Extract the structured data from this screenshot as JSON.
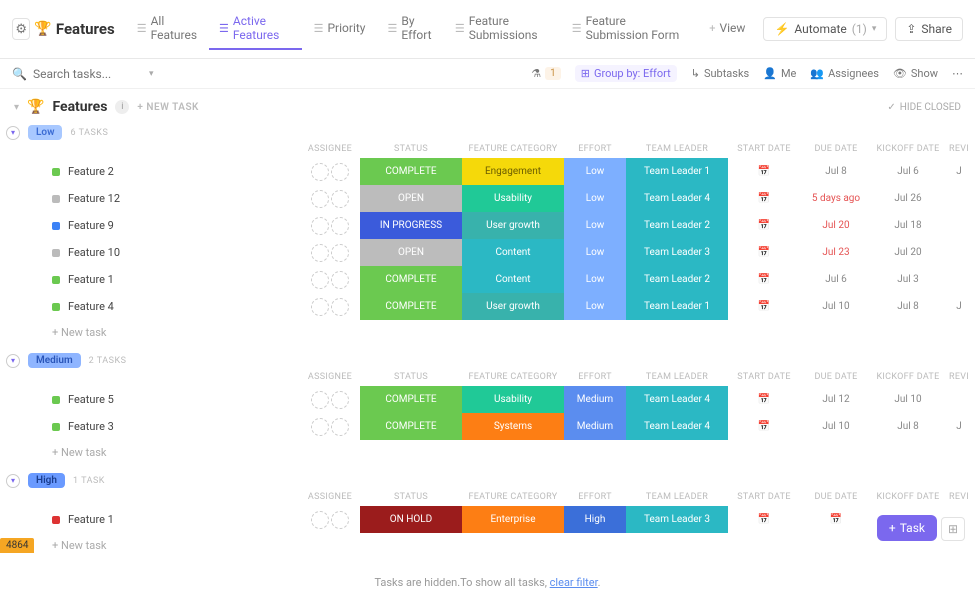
{
  "header": {
    "title": "Features",
    "views": [
      {
        "label": "All Features",
        "active": false
      },
      {
        "label": "Active Features",
        "active": true
      },
      {
        "label": "Priority",
        "active": false
      },
      {
        "label": "By Effort",
        "active": false
      },
      {
        "label": "Feature Submissions",
        "active": false
      },
      {
        "label": "Feature Submission Form",
        "active": false
      }
    ],
    "add_view": "View",
    "automate": "Automate",
    "automate_count": "(1)",
    "share": "Share"
  },
  "filterbar": {
    "search_placeholder": "Search tasks...",
    "filter_count": "1",
    "group_by": "Group by: Effort",
    "subtasks": "Subtasks",
    "me": "Me",
    "assignees": "Assignees",
    "show": "Show"
  },
  "list": {
    "title": "Features",
    "new_task": "+ NEW TASK",
    "hide_closed": "HIDE CLOSED"
  },
  "columns": [
    "",
    "ASSIGNEE",
    "STATUS",
    "FEATURE CATEGORY",
    "EFFORT",
    "TEAM LEADER",
    "START DATE",
    "DUE DATE",
    "KICKOFF DATE",
    "REVI"
  ],
  "groups": [
    {
      "pill": "Low",
      "pill_class": "pill-low",
      "count": "6 TASKS",
      "rows": [
        {
          "sq": "sq-green",
          "name": "Feature 2",
          "status": "COMPLETE",
          "status_c": "status-complete",
          "cat": "Engagement",
          "cat_c": "cat-engagement",
          "eff": "Low",
          "eff_c": "eff-low",
          "leader": "Team Leader 1",
          "due": "Jul 8",
          "due_red": false,
          "kick": "Jul 6",
          "revi": "J"
        },
        {
          "sq": "sq-grey",
          "name": "Feature 12",
          "status": "OPEN",
          "status_c": "status-open",
          "cat": "Usability",
          "cat_c": "cat-usability",
          "eff": "Low",
          "eff_c": "eff-low",
          "leader": "Team Leader 4",
          "due": "5 days ago",
          "due_red": true,
          "kick": "Jul 26",
          "revi": ""
        },
        {
          "sq": "sq-blue",
          "name": "Feature 9",
          "status": "IN PROGRESS",
          "status_c": "status-progress",
          "cat": "User growth",
          "cat_c": "cat-usergrowth",
          "eff": "Low",
          "eff_c": "eff-low",
          "leader": "Team Leader 2",
          "due": "Jul 20",
          "due_red": true,
          "kick": "Jul 18",
          "revi": ""
        },
        {
          "sq": "sq-grey",
          "name": "Feature 10",
          "status": "OPEN",
          "status_c": "status-open",
          "cat": "Content",
          "cat_c": "cat-content",
          "eff": "Low",
          "eff_c": "eff-low",
          "leader": "Team Leader 3",
          "due": "Jul 23",
          "due_red": true,
          "kick": "Jul 20",
          "revi": ""
        },
        {
          "sq": "sq-green",
          "name": "Feature 1",
          "status": "COMPLETE",
          "status_c": "status-complete",
          "cat": "Content",
          "cat_c": "cat-content",
          "eff": "Low",
          "eff_c": "eff-low",
          "leader": "Team Leader 2",
          "due": "Jul 6",
          "due_red": false,
          "kick": "Jul 3",
          "revi": ""
        },
        {
          "sq": "sq-green",
          "name": "Feature 4",
          "status": "COMPLETE",
          "status_c": "status-complete",
          "cat": "User growth",
          "cat_c": "cat-usergrowth",
          "eff": "Low",
          "eff_c": "eff-low",
          "leader": "Team Leader 1",
          "due": "Jul 10",
          "due_red": false,
          "kick": "Jul 8",
          "revi": "J"
        }
      ]
    },
    {
      "pill": "Medium",
      "pill_class": "pill-medium",
      "count": "2 TASKS",
      "rows": [
        {
          "sq": "sq-green",
          "name": "Feature 5",
          "status": "COMPLETE",
          "status_c": "status-complete",
          "cat": "Usability",
          "cat_c": "cat-usability",
          "eff": "Medium",
          "eff_c": "eff-medium",
          "leader": "Team Leader 4",
          "due": "Jul 12",
          "due_red": false,
          "kick": "Jul 10",
          "revi": ""
        },
        {
          "sq": "sq-green",
          "name": "Feature 3",
          "status": "COMPLETE",
          "status_c": "status-complete",
          "cat": "Systems",
          "cat_c": "cat-systems",
          "eff": "Medium",
          "eff_c": "eff-medium",
          "leader": "Team Leader 4",
          "due": "Jul 10",
          "due_red": false,
          "kick": "Jul 8",
          "revi": "J"
        }
      ]
    },
    {
      "pill": "High",
      "pill_class": "pill-high",
      "count": "1 TASK",
      "rows": [
        {
          "sq": "sq-red",
          "name": "Feature 1",
          "status": "ON HOLD",
          "status_c": "status-hold",
          "cat": "Enterprise",
          "cat_c": "cat-enterprise",
          "eff": "High",
          "eff_c": "eff-high",
          "leader": "Team Leader 3",
          "due": "",
          "due_red": false,
          "kick": "-",
          "revi": ""
        }
      ]
    }
  ],
  "new_task_row": "+ New task",
  "footer": {
    "msg": "Tasks are hidden.To show all tasks, ",
    "link": "clear filter"
  },
  "fab": "Task",
  "blob": "4864"
}
